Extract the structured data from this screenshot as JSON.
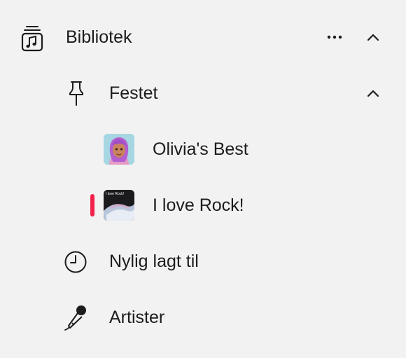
{
  "colors": {
    "accent": "#f3224b",
    "background": "#f2f2f2",
    "text": "#1c1c1e"
  },
  "sidebar": {
    "library": {
      "label": "Bibliotek",
      "icon": "music-library-icon"
    },
    "pinned": {
      "label": "Festet",
      "icon": "pin-icon"
    },
    "playlists": [
      {
        "label": "Olivia's Best",
        "artwork": "avatar-artwork"
      },
      {
        "label": "I love Rock!",
        "artwork": "rock-artwork",
        "artwork_text": "I love Rock!",
        "active": true
      }
    ],
    "recent": {
      "label": "Nylig lagt til",
      "icon": "clock-icon"
    },
    "artists": {
      "label": "Artister",
      "icon": "microphone-icon"
    }
  }
}
